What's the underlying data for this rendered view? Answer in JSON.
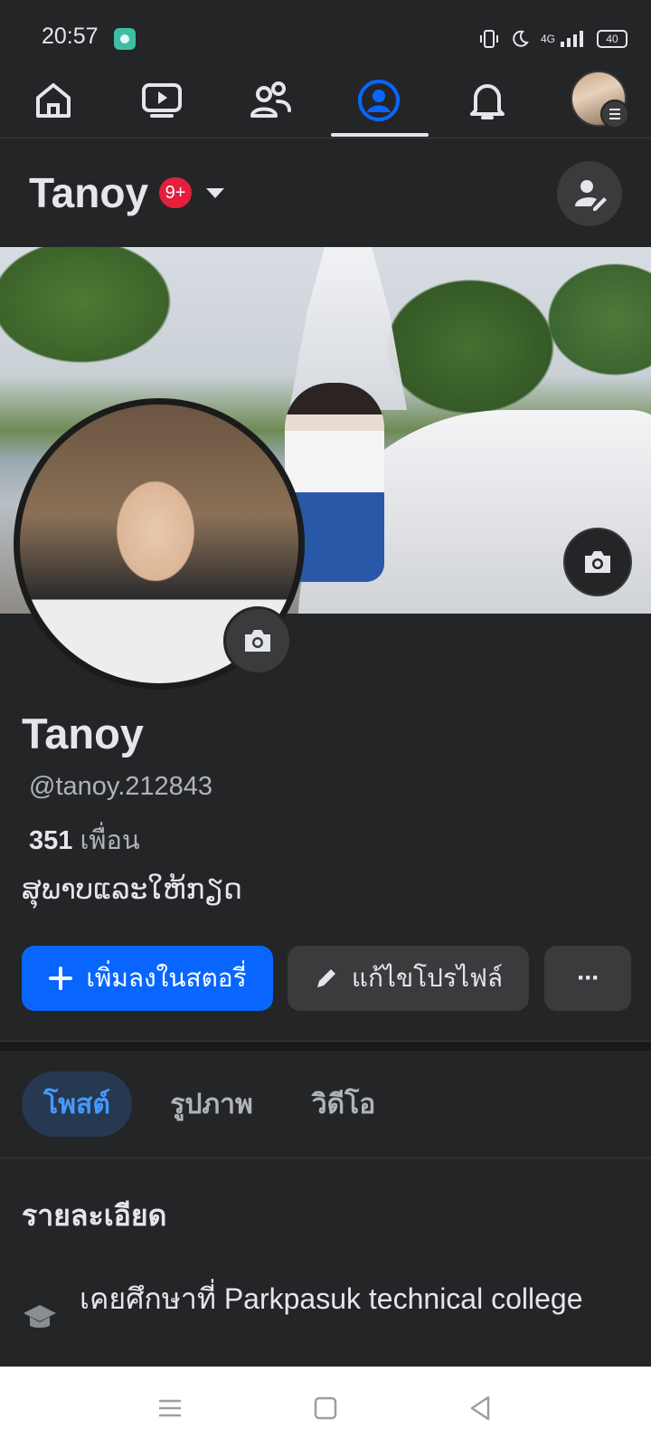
{
  "status_bar": {
    "time": "20:57",
    "network": "4G",
    "battery": "40",
    "icons": [
      "vibrate-icon",
      "moon-icon",
      "signal-icon",
      "battery-icon"
    ]
  },
  "navbar": {
    "items": [
      {
        "name": "home-icon",
        "active": false
      },
      {
        "name": "video-icon",
        "active": false
      },
      {
        "name": "friends-icon",
        "active": false
      },
      {
        "name": "profile-icon",
        "active": true
      },
      {
        "name": "bell-icon",
        "active": false
      },
      {
        "name": "menu-avatar",
        "active": false
      }
    ]
  },
  "profile_header": {
    "name": "Tanoy",
    "badge": "9+"
  },
  "profile": {
    "name": "Tanoy",
    "username": "@tanoy.212843",
    "friends_count": "351",
    "friends_label": "เพื่อน",
    "bio": "ສຸພາບແລະໃຫ້ກຽດ"
  },
  "actions": {
    "add_story": "เพิ่มลงในสตอรี่",
    "edit_profile": "แก้ไขโปรไฟล์",
    "more": "···"
  },
  "tabs": [
    {
      "label": "โพสต์",
      "active": true
    },
    {
      "label": "รูปภาพ",
      "active": false
    },
    {
      "label": "วิดีโอ",
      "active": false
    }
  ],
  "details": {
    "title": "รายละเอียด",
    "education": "เคยศึกษาที่ Parkpasuk technical college"
  },
  "colors": {
    "accent": "#0866ff",
    "background": "#242526",
    "tab_active_bg": "#263951",
    "badge": "#e41e3f"
  }
}
